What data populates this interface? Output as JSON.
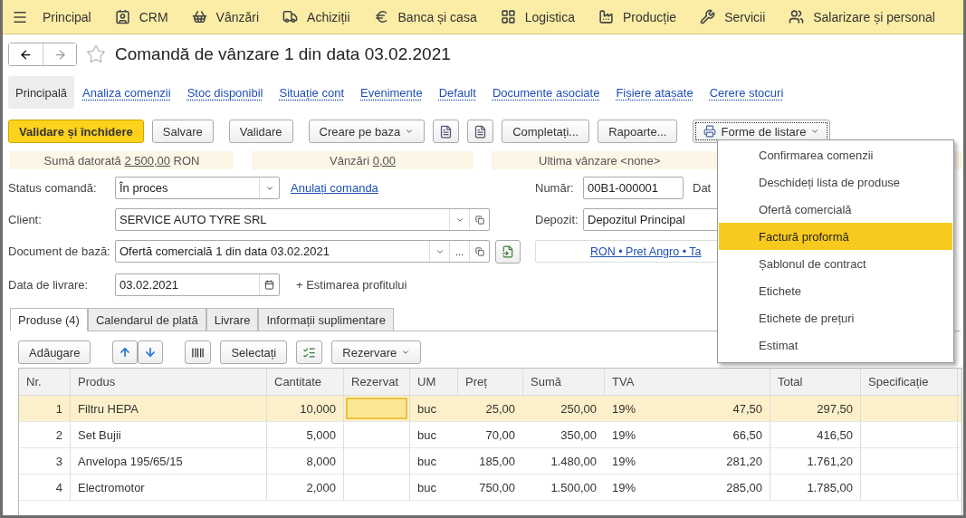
{
  "top_menu": [
    {
      "label": "Principal"
    },
    {
      "label": "CRM"
    },
    {
      "label": "Vânzări"
    },
    {
      "label": "Achiziții"
    },
    {
      "label": "Banca și casa"
    },
    {
      "label": "Logistica"
    },
    {
      "label": "Producție"
    },
    {
      "label": "Servicii"
    },
    {
      "label": "Salarizare și personal"
    }
  ],
  "document": {
    "title": "Comandă de vânzare 1 din data 03.02.2021",
    "favorite": false
  },
  "nav_tabs": [
    {
      "label": "Principală",
      "selected": true
    },
    {
      "label": "Analiza comenzii",
      "selected": false
    },
    {
      "label": "Stoc disponibil",
      "selected": false
    },
    {
      "label": "Situație cont",
      "selected": false
    },
    {
      "label": "Evenimente",
      "selected": false
    },
    {
      "label": "Default",
      "selected": false
    },
    {
      "label": "Documente asociate",
      "selected": false
    },
    {
      "label": "Fișiere atașate",
      "selected": false
    },
    {
      "label": "Cerere stocuri",
      "selected": false
    }
  ],
  "toolbar": [
    {
      "kind": "primary",
      "label": "Validare și închidere"
    },
    {
      "kind": "button",
      "label": "Salvare"
    },
    {
      "kind": "button",
      "label": "Validare"
    },
    {
      "kind": "dropdown",
      "label": "Creare pe baza"
    },
    {
      "kind": "icon"
    },
    {
      "kind": "icon"
    },
    {
      "kind": "button",
      "label": "Completați..."
    },
    {
      "kind": "button",
      "label": "Rapoarte..."
    },
    {
      "kind": "print",
      "label": "Forme de listare",
      "expanded": true
    }
  ],
  "info_strip": [
    {
      "label": "Sumă datorată",
      "value": "2 500,00",
      "unit": "RON"
    },
    {
      "label": "Vânzări",
      "value": "0,00"
    },
    {
      "label": "Ultima vânzare <none>"
    }
  ],
  "form": {
    "status": {
      "label": "Status comandă:",
      "value": "În proces",
      "link": "Anulați comanda"
    },
    "client": {
      "label": "Client:",
      "value": "SERVICE AUTO TYRE SRL"
    },
    "base_document": {
      "label": "Document de bază:",
      "value": "Ofertă comercială 1 din data 03.02.2021",
      "button": "..."
    },
    "delivery_date": {
      "label": "Data de livrare:",
      "value": "03.02.2021",
      "link": "+ Estimarea profitului"
    },
    "number": {
      "label": "Număr:",
      "value": "00B1-000001",
      "next_label": "Dat"
    },
    "warehouse": {
      "label": "Depozit:",
      "value": "Depozitul Principal"
    },
    "price_link": "RON • Pret Angro • Ta"
  },
  "tabs": [
    {
      "label": "Produse (4)",
      "selected": true
    },
    {
      "label": "Calendarul de plată",
      "selected": false
    },
    {
      "label": "Livrare",
      "selected": false
    },
    {
      "label": "Informații suplimentare",
      "selected": false
    }
  ],
  "table_toolbar": {
    "add": "Adăugare",
    "select": "Selectați",
    "reserve": "Rezervare"
  },
  "table": {
    "columns": [
      "Nr.",
      "Produs",
      "Cantitate",
      "Rezervat",
      "UM",
      "Preț",
      "Sumă",
      "TVA",
      "Total",
      "Specificație"
    ],
    "rows": [
      {
        "selected": true,
        "cells": [
          "1",
          "Filtru HEPA",
          "10,000",
          "",
          "buc",
          "25,00",
          "250,00",
          "19%",
          "47,50",
          "297,50",
          ""
        ]
      },
      {
        "selected": false,
        "cells": [
          "2",
          "Set Bujii",
          "5,000",
          "",
          "buc",
          "70,00",
          "350,00",
          "19%",
          "66,50",
          "416,50",
          ""
        ]
      },
      {
        "selected": false,
        "cells": [
          "3",
          "Anvelopa 195/65/15",
          "8,000",
          "",
          "buc",
          "185,00",
          "1.480,00",
          "19%",
          "281,20",
          "1.761,20",
          ""
        ]
      },
      {
        "selected": false,
        "cells": [
          "4",
          "Electromotor",
          "2,000",
          "",
          "buc",
          "750,00",
          "1.500,00",
          "19%",
          "285,00",
          "1.785,00",
          ""
        ]
      }
    ]
  },
  "print_menu": [
    {
      "label": "Confirmarea comenzii",
      "selected": false
    },
    {
      "label": "Deschideți lista de produse",
      "selected": false
    },
    {
      "label": "Ofertă comercială",
      "selected": false
    },
    {
      "label": "Factură proformă",
      "selected": true
    },
    {
      "label": "Șablonul de contract",
      "selected": false
    },
    {
      "label": "Etichete",
      "selected": false
    },
    {
      "label": "Etichete de prețuri",
      "selected": false
    },
    {
      "label": "Estimat",
      "selected": false
    }
  ]
}
